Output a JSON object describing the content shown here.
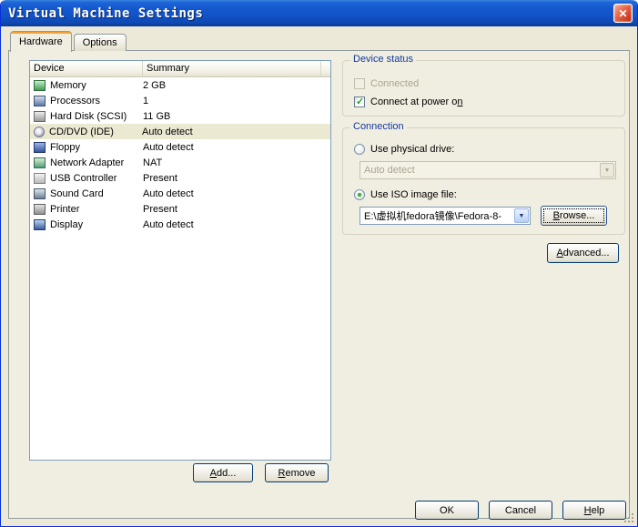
{
  "window": {
    "title": "Virtual Machine Settings"
  },
  "icons": {
    "close": "✕",
    "dropdown_arrow": "▼"
  },
  "tabs": [
    {
      "label": "Hardware",
      "active": true
    },
    {
      "label": "Options",
      "active": false
    }
  ],
  "device_table": {
    "headers": [
      "Device",
      "Summary"
    ],
    "rows": [
      {
        "device": "Memory",
        "summary": "2 GB",
        "icon": "memory-icon",
        "selected": false
      },
      {
        "device": "Processors",
        "summary": "1",
        "icon": "processor-icon",
        "selected": false
      },
      {
        "device": "Hard Disk (SCSI)",
        "summary": "11 GB",
        "icon": "hard-disk-icon",
        "selected": false
      },
      {
        "device": "CD/DVD (IDE)",
        "summary": "Auto detect",
        "icon": "cd-dvd-icon",
        "selected": true
      },
      {
        "device": "Floppy",
        "summary": "Auto detect",
        "icon": "floppy-icon",
        "selected": false
      },
      {
        "device": "Network Adapter",
        "summary": "NAT",
        "icon": "network-adapter-icon",
        "selected": false
      },
      {
        "device": "USB Controller",
        "summary": "Present",
        "icon": "usb-icon",
        "selected": false
      },
      {
        "device": "Sound Card",
        "summary": "Auto detect",
        "icon": "sound-card-icon",
        "selected": false
      },
      {
        "device": "Printer",
        "summary": "Present",
        "icon": "printer-icon",
        "selected": false
      },
      {
        "device": "Display",
        "summary": "Auto detect",
        "icon": "display-icon",
        "selected": false
      }
    ]
  },
  "list_buttons": {
    "add": {
      "label": "Add...",
      "accel": "A"
    },
    "remove": {
      "label": "Remove",
      "accel": "R"
    }
  },
  "device_status": {
    "title": "Device status",
    "connected": {
      "label": "Connected",
      "checked": false,
      "disabled": true
    },
    "connect_at_power_on": {
      "label": "Connect at power on",
      "checked": true,
      "accel": "n"
    }
  },
  "connection": {
    "title": "Connection",
    "use_physical_drive": {
      "label": "Use physical drive:",
      "selected": false
    },
    "physical_drive_combo": {
      "value": "Auto detect",
      "disabled": true
    },
    "use_iso": {
      "label": "Use ISO image file:",
      "selected": true
    },
    "iso_combo": {
      "value": "E:\\虚拟机fedora镜像\\Fedora-8-",
      "disabled": false
    },
    "browse": {
      "label": "Browse...",
      "accel": "B"
    },
    "advanced": {
      "label": "Advanced...",
      "accel": "A"
    }
  },
  "footer": {
    "ok": {
      "label": "OK"
    },
    "cancel": {
      "label": "Cancel"
    },
    "help": {
      "label": "Help",
      "accel": "H"
    }
  },
  "colors": {
    "group_label_blue": "#16399e",
    "check_green": "#21a121",
    "radio_green": "#3fae46",
    "selected_row_bg": "#ece9d3",
    "titlebar_blue": "#1152c6",
    "close_red": "#cc3b22"
  }
}
